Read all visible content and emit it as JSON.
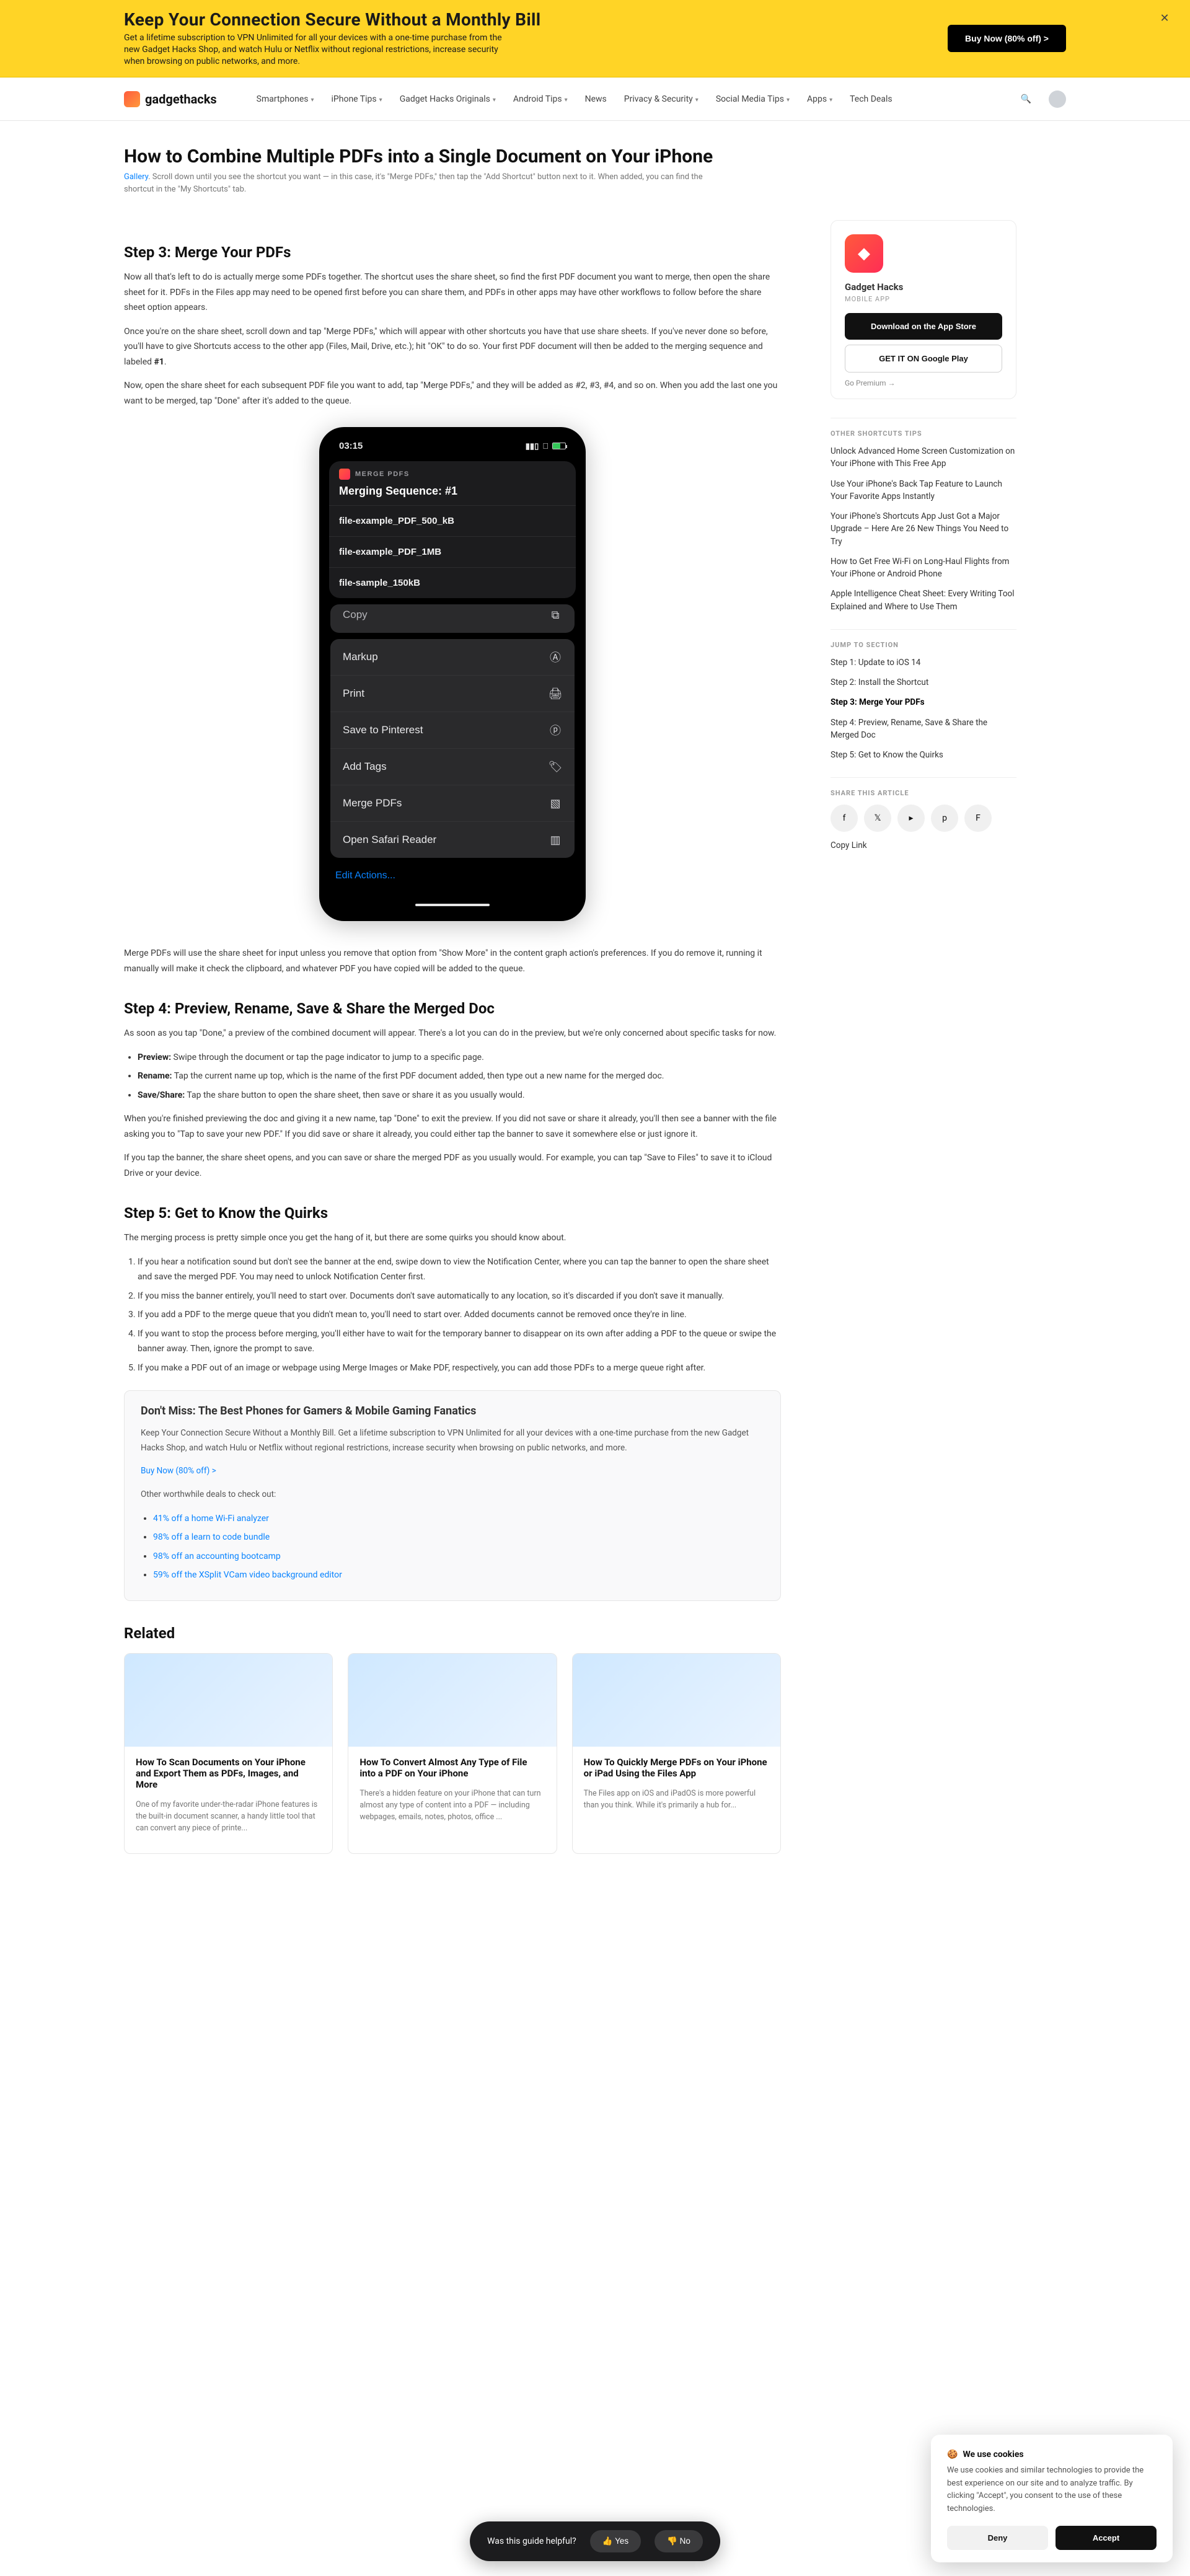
{
  "banner": {
    "title": "Keep Your Connection Secure Without a Monthly Bill",
    "subtitle": "Get a lifetime subscription to VPN Unlimited for all your devices with a one-time purchase from the new Gadget Hacks Shop, and watch Hulu or Netflix without regional restrictions, increase security when browsing on public networks, and more.",
    "cta": "Buy Now (80% off) >",
    "close": "✕"
  },
  "nav": {
    "brand": "gadgethacks",
    "items": [
      "Smartphones",
      "iPhone Tips",
      "Gadget Hacks Originals",
      "Android Tips",
      "News",
      "Privacy & Security",
      "Social Media Tips",
      "Apps",
      "Tech Deals"
    ],
    "dropdowns": [
      true,
      true,
      true,
      true,
      false,
      true,
      true,
      true,
      false
    ]
  },
  "head": {
    "title": "How to Combine Multiple PDFs into a Single Document on Your iPhone",
    "scroll_note_prefix": "Scroll down until you see the shortcut you want — in this case, it's \"Merge PDFs,\" then tap the \"Add Shortcut\" button next to it. When added, you can find the shortcut in the \"My Shortcuts\" tab.",
    "gallery_link": "Gallery"
  },
  "article": {
    "step3_title": "Step 3: Merge Your PDFs",
    "s3_p1": "Now all that's left to do is actually merge some PDFs together. The shortcut uses the share sheet, so find the first PDF document you want to merge, then open the share sheet for it. PDFs in the Files app may need to be opened first before you can share them, and PDFs in other apps may have other workflows to follow before the share sheet option appears.",
    "s3_p2_a": "Once you're on the share sheet, scroll down and tap \"Merge PDFs,\" which will appear with other shortcuts you have that use share sheets. If you've never done so before, you'll have to give Shortcuts access to the other app (Files, Mail, Drive, etc.); hit \"OK\" to do so. Your first PDF document will then be added to the merging sequence and labeled ",
    "s3_p2_seq": "#1",
    "s3_p2_b": ".",
    "s3_p3": "Now, open the share sheet for each subsequent PDF file you want to add, tap \"Merge PDFs,\" and they will be added as #2, #3, #4, and so on. When you add the last one you want to be merged, tap \"Done\" after it's added to the queue.",
    "s3_quote": "Merge PDFs will use the share sheet for input unless you remove that option from \"Show More\" in the content graph action's preferences. If you do remove it, running it manually will make it check the clipboard, and whatever PDF you have copied will be added to the queue.",
    "step4_title": "Step 4: Preview, Rename, Save & Share the Merged Doc",
    "s4_intro": "As soon as you tap \"Done,\" a preview of the combined document will appear. There's a lot you can do in the preview, but we're only concerned about specific tasks for now.",
    "s4_bullets": [
      {
        "b": "Preview:",
        "t": " Swipe through the document or tap the page indicator to jump to a specific page."
      },
      {
        "b": "Rename:",
        "t": " Tap the current name up top, which is the name of the first PDF document added, then type out a new name for the merged doc."
      },
      {
        "b": "Save/Share:",
        "t": " Tap the share button to open the share sheet, then save or share it as you usually would."
      }
    ],
    "s4_p2": "When you're finished previewing the doc and giving it a new name, tap \"Done\" to exit the preview. If you did not save or share it already, you'll then see a banner with the file asking you to \"Tap to save your new PDF.\" If you did save or share it already, you could either tap the banner to save it somewhere else or just ignore it.",
    "s4_p3": "If you tap the banner, the share sheet opens, and you can save or share the merged PDF as you usually would. For example, you can tap \"Save to Files\" to save it to iCloud Drive or your device.",
    "step5_title": "Step 5: Get to Know the Quirks",
    "s5_intro": "The merging process is pretty simple once you get the hang of it, but there are some quirks you should know about.",
    "s5_items": [
      "If you hear a notification sound but don't see the banner at the end, swipe down to view the Notification Center, where you can tap the banner to open the share sheet and save the merged PDF. You may need to unlock Notification Center first.",
      "If you miss the banner entirely, you'll need to start over. Documents don't save automatically to any location, so it's discarded if you don't save it manually.",
      "If you add a PDF to the merge queue that you didn't mean to, you'll need to start over. Added documents cannot be removed once they're in line.",
      "If you want to stop the process before merging, you'll either have to wait for the temporary banner to disappear on its own after adding a PDF to the queue or swipe the banner away. Then, ignore the prompt to save.",
      "If you make a PDF out of an image or webpage using Merge Images or Make PDF, respectively, you can add those PDFs to a merge queue right after."
    ],
    "infobox": {
      "title": "Don't Miss: The Best Phones for Gamers & Mobile Gaming Fanatics",
      "lead": "Keep Your Connection Secure Without a Monthly Bill. Get a lifetime subscription to VPN Unlimited for all your devices with a one-time purchase from the new Gadget Hacks Shop, and watch Hulu or Netflix without regional restrictions, increase security when browsing on public networks, and more.",
      "buy": "Buy Now (80% off) >",
      "deals_head": "Other worthwhile deals to check out:",
      "deals": [
        "41% off a home Wi-Fi analyzer",
        "98% off a learn to code bundle",
        "98% off an accounting bootcamp",
        "59% off the XSplit VCam video background editor"
      ]
    },
    "related_title": "Related",
    "related": [
      {
        "t": "How To Scan Documents on Your iPhone and Export Them as PDFs, Images, and More",
        "s": "One of my favorite under-the-radar iPhone features is the built-in document scanner, a handy little tool that can convert any piece of printe..."
      },
      {
        "t": "How To Convert Almost Any Type of File into a PDF on Your iPhone",
        "s": "There's a hidden feature on your iPhone that can turn almost any type of content into a PDF — including webpages, emails, notes, photos, office ..."
      },
      {
        "t": "How To Quickly Merge PDFs on Your iPhone or iPad Using the Files App",
        "s": "The Files app on iOS and iPadOS is more powerful than you think. While it's primarily a hub for..."
      }
    ]
  },
  "phone": {
    "time": "03:15",
    "notif_app": "MERGE PDFS",
    "notif_title": "Merging Sequence: #1",
    "files": [
      "file-example_PDF_500_kB",
      "file-example_PDF_1MB",
      "file-sample_150kB"
    ],
    "rows": {
      "copy": "Copy",
      "markup": "Markup",
      "print": "Print",
      "pin": "Save to Pinterest",
      "tags": "Add Tags",
      "merge": "Merge PDFs",
      "reader": "Open Safari Reader",
      "edit": "Edit Actions..."
    }
  },
  "sidebar": {
    "app_name": "Gadget Hacks",
    "app_sub": "MOBILE APP",
    "appstore": "Download on the App Store",
    "play": "GET IT ON Google Play",
    "premium": "Go Premium →",
    "other_title": "OTHER SHORTCUTS TIPS",
    "other": [
      "Unlock Advanced Home Screen Customization on Your iPhone with This Free App",
      "Use Your iPhone's Back Tap Feature to Launch Your Favorite Apps Instantly",
      "Your iPhone's Shortcuts App Just Got a Major Upgrade – Here Are 26 New Things You Need to Try",
      "How to Get Free Wi-Fi on Long-Haul Flights from Your iPhone or Android Phone",
      "Apple Intelligence Cheat Sheet: Every Writing Tool Explained and Where to Use Them"
    ],
    "toc_title": "JUMP TO SECTION",
    "toc": [
      {
        "t": "Step 1: Update to iOS 14",
        "sel": false
      },
      {
        "t": "Step 2: Install the Shortcut",
        "sel": false
      },
      {
        "t": "Step 3: Merge Your PDFs",
        "sel": true
      },
      {
        "t": "Step 4: Preview, Rename, Save & Share the Merged Doc",
        "sel": false
      },
      {
        "t": "Step 5: Get to Know the Quirks",
        "sel": false
      }
    ],
    "share_title": "SHARE THIS ARTICLE",
    "copy": "Copy Link"
  },
  "rate": {
    "q": "Was this guide helpful?",
    "yes": "👍  Yes",
    "no": "👎  No"
  },
  "gdpr": {
    "title": "We use cookies",
    "body": "We use cookies and similar technologies to provide the best experience on our site and to analyze traffic. By clicking \"Accept\", you consent to the use of these technologies.",
    "accept": "Accept",
    "deny": "Deny"
  }
}
